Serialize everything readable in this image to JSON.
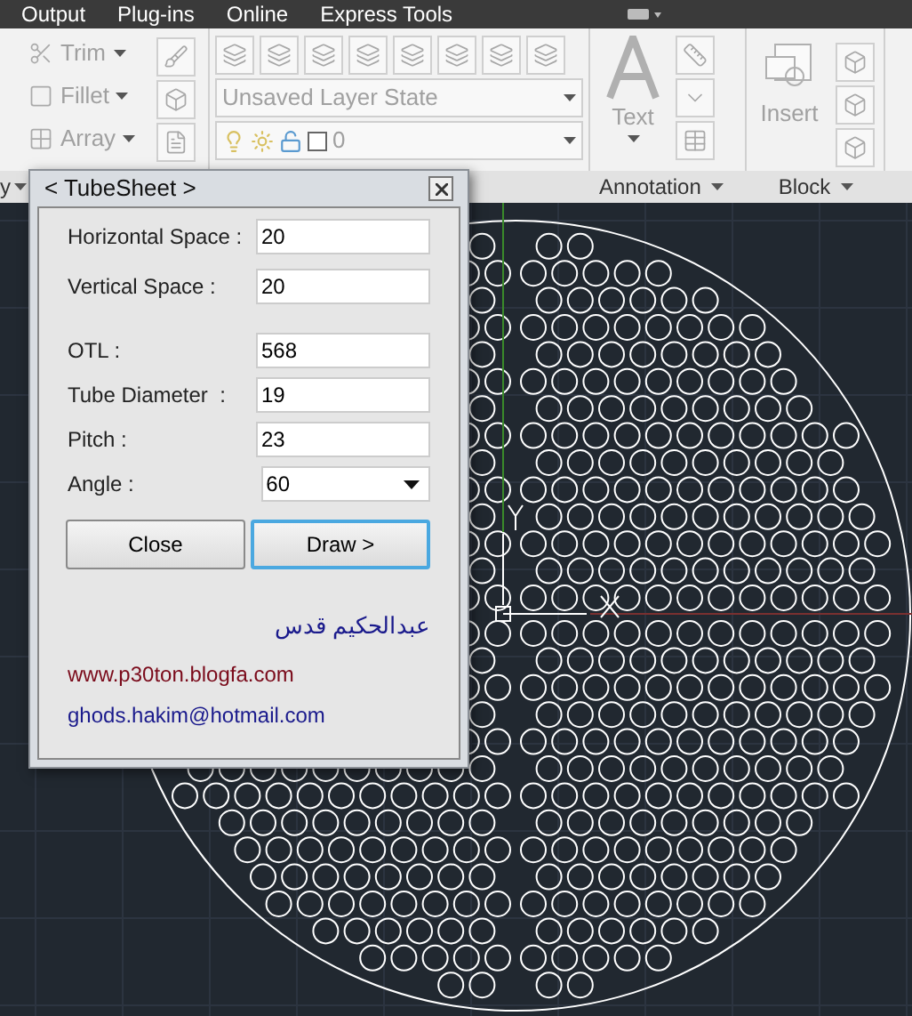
{
  "menu_bar": {
    "tabs": [
      {
        "label": "Output"
      },
      {
        "label": "Plug-ins"
      },
      {
        "label": "Online"
      },
      {
        "label": "Express Tools"
      }
    ]
  },
  "ribbon": {
    "modify": {
      "tools": [
        {
          "label": "Trim"
        },
        {
          "label": "Fillet"
        },
        {
          "label": "Array"
        }
      ]
    },
    "layers": {
      "layer_state": "Unsaved Layer State",
      "current_layer": "0"
    },
    "annotation": {
      "tool": "Text"
    },
    "block": {
      "tool": "Insert"
    },
    "panel_labels": [
      {
        "label": "y"
      },
      {
        "label": "Annotation"
      },
      {
        "label": "Block"
      }
    ]
  },
  "dialog": {
    "title": "< TubeSheet >",
    "field_groups": [
      [
        {
          "label": "Horizontal Space :",
          "value": "20",
          "kind": "text"
        },
        {
          "label": "Vertical Space :",
          "value": "20",
          "kind": "text"
        }
      ],
      [
        {
          "label": "OTL :",
          "value": "568",
          "kind": "text"
        },
        {
          "label": "Tube Diameter  :",
          "value": "19",
          "kind": "text"
        },
        {
          "label": "Pitch :",
          "value": "23",
          "kind": "text"
        },
        {
          "label": "Angle :",
          "value": "60",
          "kind": "select"
        }
      ]
    ],
    "buttons": [
      {
        "label": "Close",
        "selected": false
      },
      {
        "label": "Draw >",
        "selected": true
      }
    ],
    "author": "عبدالحکیم قدس",
    "website": "www.p30ton.blogfa.com",
    "email": "ghods.hakim@hotmail.com"
  }
}
